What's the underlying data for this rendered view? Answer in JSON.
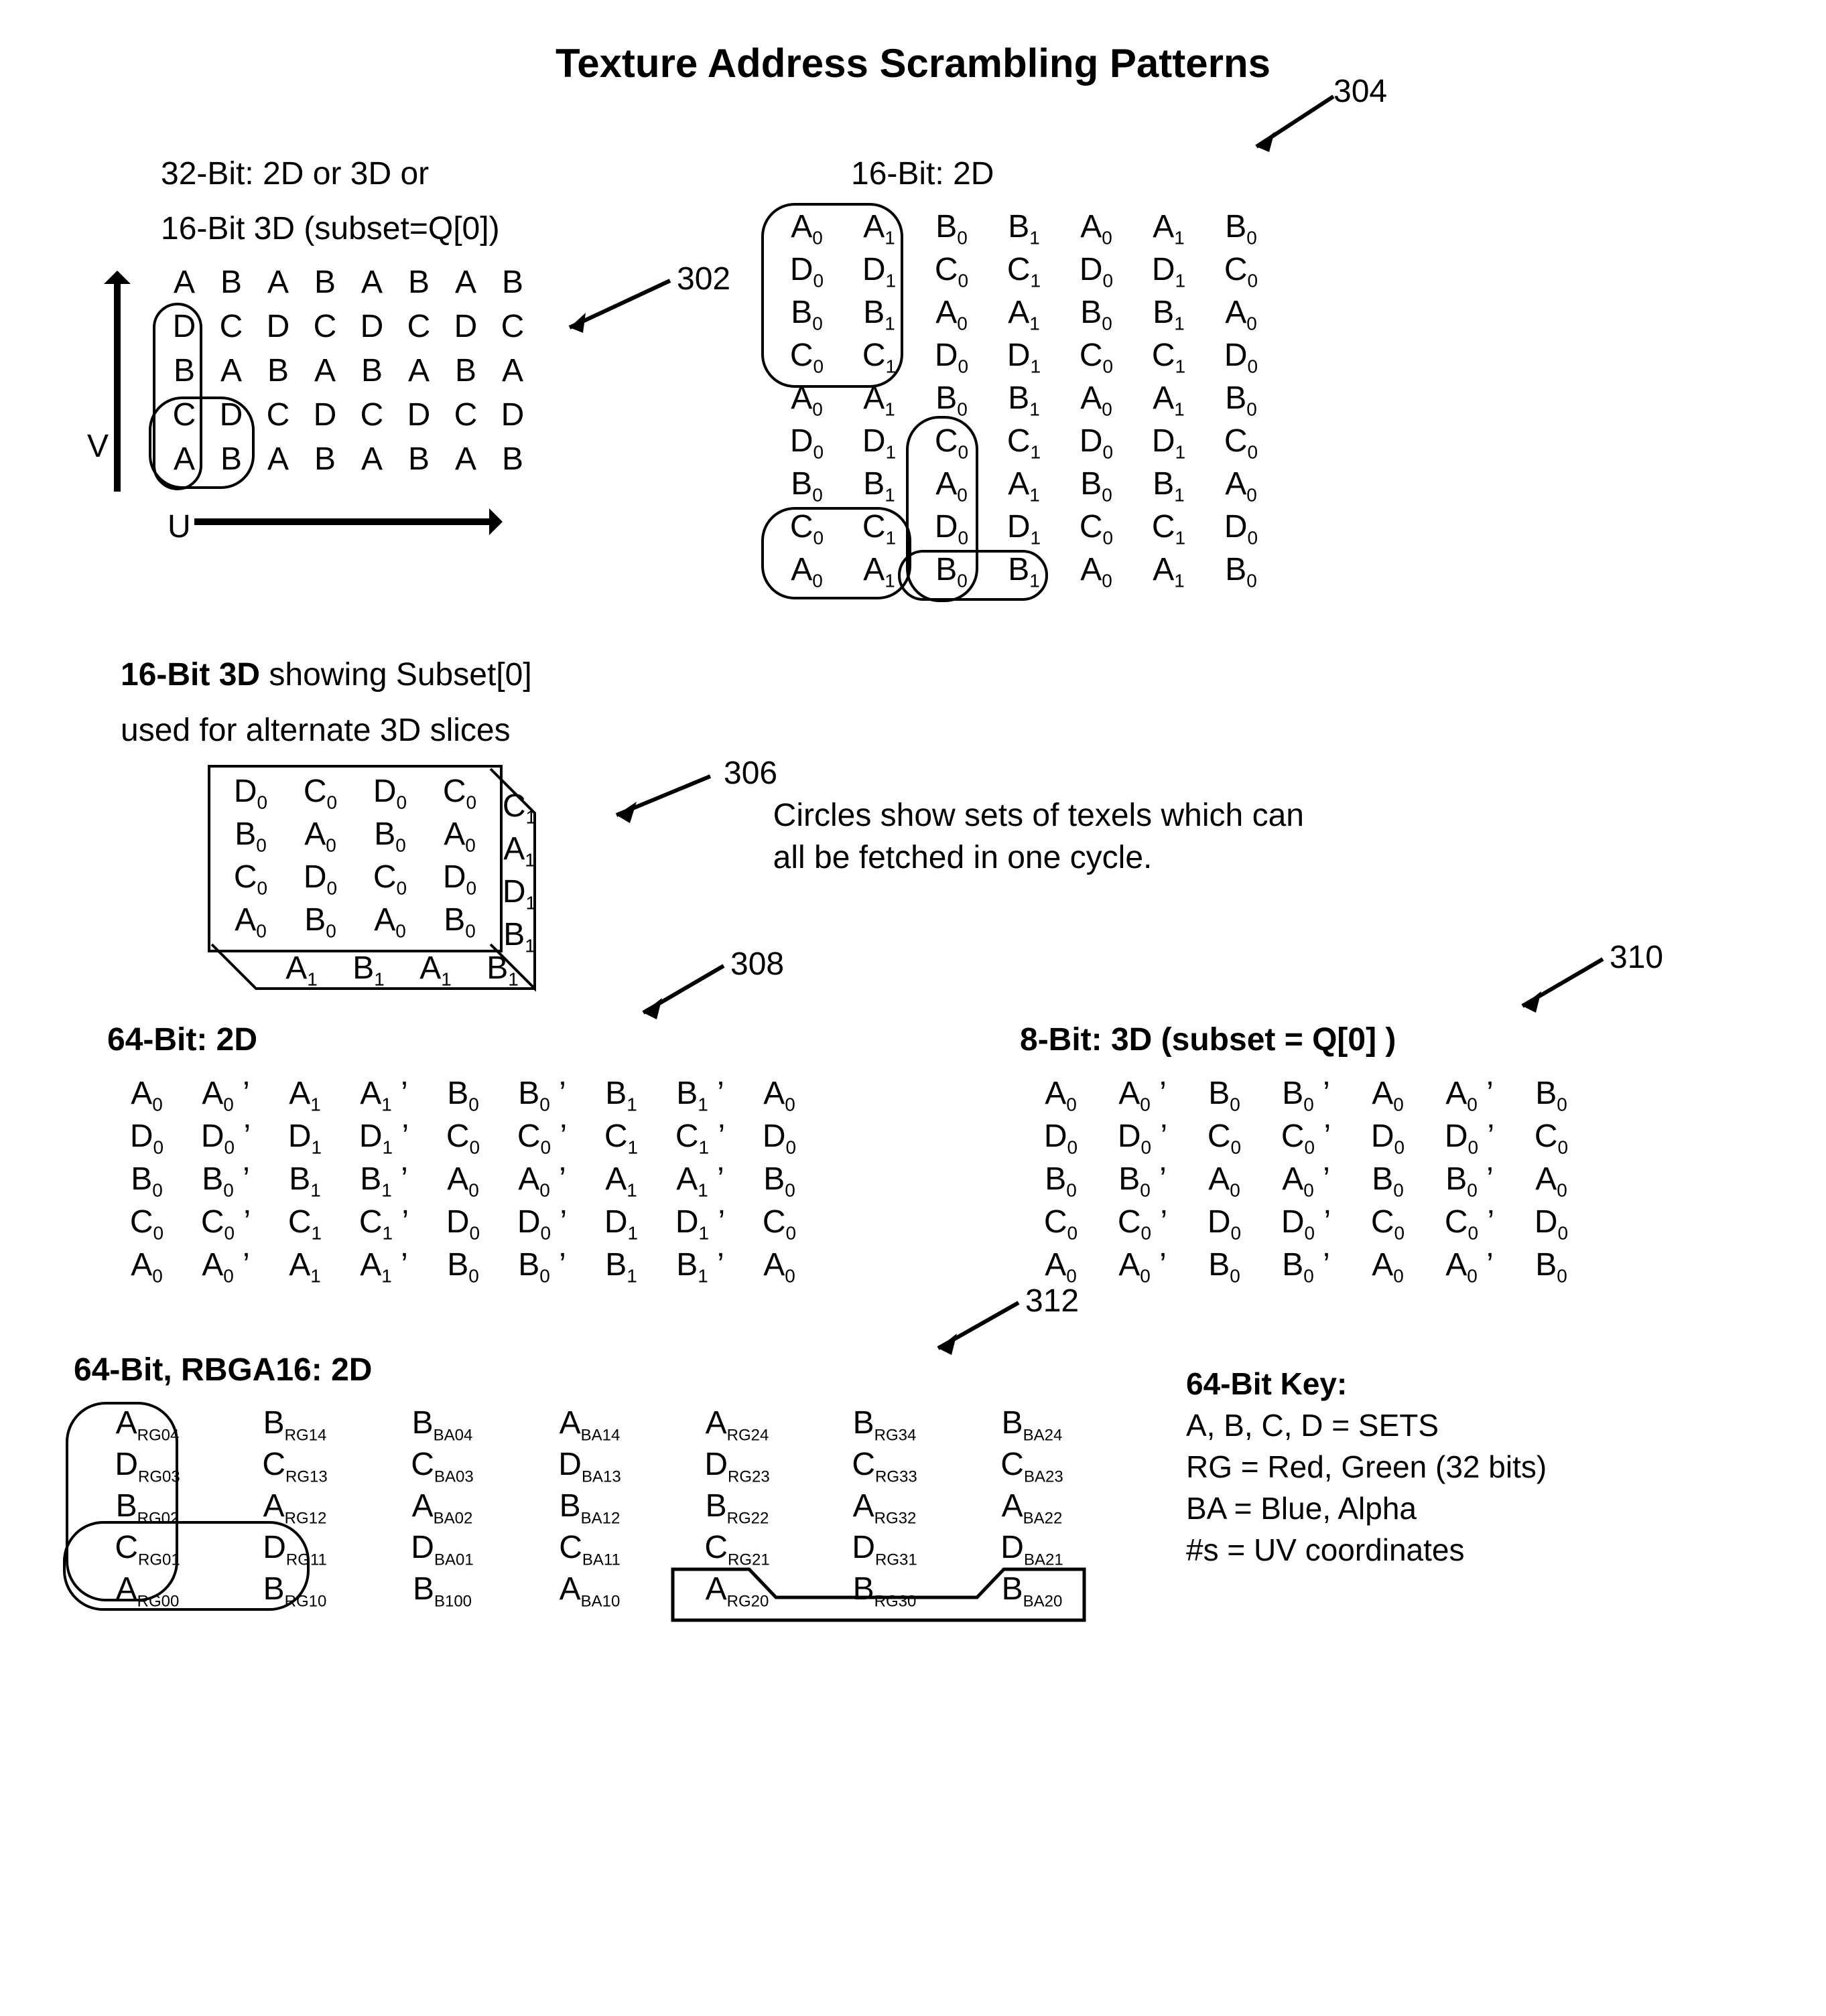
{
  "title": "Texture Address Scrambling Patterns",
  "blocks": {
    "b302": {
      "ref": "302",
      "label1": "32-Bit: 2D or 3D or",
      "label2": "16-Bit 3D (subset=Q[0])",
      "axisV": "V",
      "axisU": "U",
      "rows": [
        [
          "A",
          "B",
          "A",
          "B",
          "A",
          "B",
          "A",
          "B"
        ],
        [
          "D",
          "C",
          "D",
          "C",
          "D",
          "C",
          "D",
          "C"
        ],
        [
          "B",
          "A",
          "B",
          "A",
          "B",
          "A",
          "B",
          "A"
        ],
        [
          "C",
          "D",
          "C",
          "D",
          "C",
          "D",
          "C",
          "D"
        ],
        [
          "A",
          "B",
          "A",
          "B",
          "A",
          "B",
          "A",
          "B"
        ]
      ]
    },
    "b304": {
      "ref": "304",
      "label": "16-Bit: 2D",
      "rows": [
        [
          "A0",
          "A1",
          "B0",
          "B1",
          "A0",
          "A1",
          "B0"
        ],
        [
          "D0",
          "D1",
          "C0",
          "C1",
          "D0",
          "D1",
          "C0"
        ],
        [
          "B0",
          "B1",
          "A0",
          "A1",
          "B0",
          "B1",
          "A0"
        ],
        [
          "C0",
          "C1",
          "D0",
          "D1",
          "C0",
          "C1",
          "D0"
        ],
        [
          "A0",
          "A1",
          "B0",
          "B1",
          "A0",
          "A1",
          "B0"
        ],
        [
          "D0",
          "D1",
          "C0",
          "C1",
          "D0",
          "D1",
          "C0"
        ],
        [
          "B0",
          "B1",
          "A0",
          "A1",
          "B0",
          "B1",
          "A0"
        ],
        [
          "C0",
          "C1",
          "D0",
          "D1",
          "C0",
          "C1",
          "D0"
        ],
        [
          "A0",
          "A1",
          "B0",
          "B1",
          "A0",
          "A1",
          "B0"
        ]
      ]
    },
    "b306": {
      "ref": "306",
      "label1": "16-Bit 3D",
      "label2": " showing Subset[0]",
      "label3": "used for alternate 3D slices",
      "front": [
        [
          "D0",
          "C0",
          "D0",
          "C0"
        ],
        [
          "B0",
          "A0",
          "B0",
          "A0"
        ],
        [
          "C0",
          "D0",
          "C0",
          "D0"
        ],
        [
          "A0",
          "B0",
          "A0",
          "B0"
        ]
      ],
      "side": [
        "C1",
        "A1",
        "D1",
        "B1"
      ],
      "bottom": [
        "A1",
        "B1",
        "A1",
        "B1"
      ]
    },
    "b308": {
      "ref": "308",
      "label": "64-Bit: 2D",
      "rows": [
        [
          "A0",
          "A0'",
          "A1",
          "A1'",
          "B0",
          "B0'",
          "B1",
          "B1'",
          "A0"
        ],
        [
          "D0",
          "D0'",
          "D1",
          "D1'",
          "C0",
          "C0'",
          "C1",
          "C1'",
          "D0"
        ],
        [
          "B0",
          "B0'",
          "B1",
          "B1'",
          "A0",
          "A0'",
          "A1",
          "A1'",
          "B0"
        ],
        [
          "C0",
          "C0'",
          "C1",
          "C1'",
          "D0",
          "D0'",
          "D1",
          "D1'",
          "C0"
        ],
        [
          "A0",
          "A0'",
          "A1",
          "A1'",
          "B0",
          "B0'",
          "B1",
          "B1'",
          "A0"
        ]
      ]
    },
    "b310": {
      "ref": "310",
      "label": "8-Bit: 3D (subset = Q[0] )",
      "rows": [
        [
          "A0",
          "A0'",
          "B0",
          "B0'",
          "A0",
          "A0'",
          "B0"
        ],
        [
          "D0",
          "D0'",
          "C0",
          "C0'",
          "D0",
          "D0'",
          "C0"
        ],
        [
          "B0",
          "B0'",
          "A0",
          "A0'",
          "B0",
          "B0'",
          "A0"
        ],
        [
          "C0",
          "C0'",
          "D0",
          "D0'",
          "C0",
          "C0'",
          "D0"
        ],
        [
          "A0",
          "A0'",
          "B0",
          "B0'",
          "A0",
          "A0'",
          "B0"
        ]
      ]
    },
    "b312": {
      "ref": "312",
      "label": "64-Bit, RBGA16: 2D",
      "rows": [
        [
          "A_RG04",
          "B_RG14",
          "B_BA04",
          "A_BA14",
          "A_RG24",
          "B_RG34",
          "B_BA24"
        ],
        [
          "D_RG03",
          "C_RG13",
          "C_BA03",
          "D_BA13",
          "D_RG23",
          "C_RG33",
          "C_BA23"
        ],
        [
          "B_RG02",
          "A_RG12",
          "A_BA02",
          "B_BA12",
          "B_RG22",
          "A_RG32",
          "A_BA22"
        ],
        [
          "C_RG01",
          "D_RG11",
          "D_BA01",
          "C_BA11",
          "C_RG21",
          "D_RG31",
          "D_BA21"
        ],
        [
          "A_RG00",
          "B_RG10",
          "B_B100",
          "A_BA10",
          "A_RG20",
          "B_RG30",
          "B_BA20"
        ]
      ]
    }
  },
  "note": "Circles show sets of texels which can all be fetched in one cycle.",
  "key": {
    "heading": "64-Bit Key:",
    "l1": "A, B, C, D = SETS",
    "l2": "RG = Red, Green (32 bits)",
    "l3": "BA = Blue, Alpha",
    "l4": "#s = UV coordinates"
  }
}
